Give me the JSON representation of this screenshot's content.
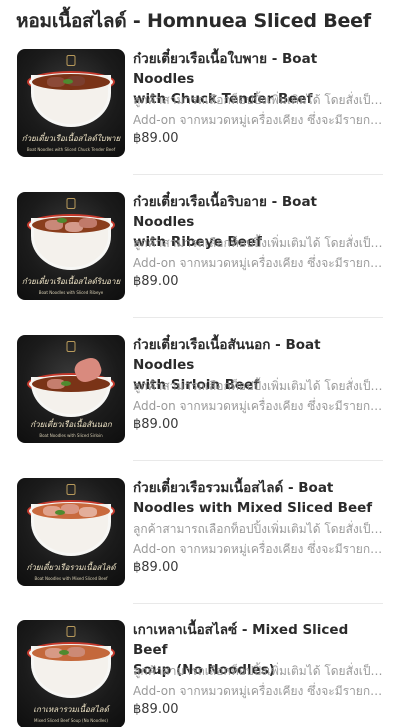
{
  "section": {
    "title": "หอมเนื้อสไลด์ - Homnuea Sliced Beef"
  },
  "items": [
    {
      "name_line1": "ก๋วยเตี๋ยวเรือเนื้อใบพาย - Boat Noodles",
      "name_line2": "with Chuck Tender Beef",
      "desc_line1": "ลูกค้าสามารถเลือกท็อปปิ้งเพิ่มเติมได้ โดยสั่งเป็นเมนู",
      "desc_line2": "Add-on จากหมวดหมู่เครื่องเคียง ซึ่งจะมีรายการต่...",
      "price": "฿89.00",
      "image_caption": "ก๋วยเตี๋ยวเรือเนื้อสไลด์ใบพาย",
      "image_caption_en": "Boat Noodles with Sliced Chuck Tender Beef"
    },
    {
      "name_line1": "ก๋วยเตี๋ยวเรือเนื้อริบอาย - Boat Noodles",
      "name_line2": "with Ribeye Beef",
      "desc_line1": "ลูกค้าสามารถเลือกท็อปปิ้งเพิ่มเติมได้ โดยสั่งเป็นเมนู",
      "desc_line2": "Add-on จากหมวดหมู่เครื่องเคียง ซึ่งจะมีรายการต่...",
      "price": "฿89.00",
      "image_caption": "ก๋วยเตี๋ยวเรือเนื้อสไลด์ริบอาย",
      "image_caption_en": "Boat Noodles with Sliced Ribeye"
    },
    {
      "name_line1": "ก๋วยเตี๋ยวเรือเนื้อสันนอก - Boat Noodles",
      "name_line2": "with Sirloin Beef",
      "desc_line1": "ลูกค้าสามารถเลือกท็อปปิ้งเพิ่มเติมได้ โดยสั่งเป็นเมนู",
      "desc_line2": "Add-on จากหมวดหมู่เครื่องเคียง ซึ่งจะมีรายการต่...",
      "price": "฿89.00",
      "image_caption": "ก๋วยเตี๋ยวเรือเนื้อสันนอก",
      "image_caption_en": "Boat Noodles with Sliced Sirloin"
    },
    {
      "name_line1": "ก๋วยเตี๋ยวเรือรวมเนื้อสไลด์ - Boat",
      "name_line2": "Noodles with Mixed Sliced Beef",
      "desc_line1": "ลูกค้าสามารถเลือกท็อปปิ้งเพิ่มเติมได้ โดยสั่งเป็นเมนู",
      "desc_line2": "Add-on จากหมวดหมู่เครื่องเคียง ซึ่งจะมีรายการต่...",
      "price": "฿89.00",
      "image_caption": "ก๋วยเตี๋ยวเรือรวมเนื้อสไลด์",
      "image_caption_en": "Boat Noodles with Mixed Sliced Beef"
    },
    {
      "name_line1": "เกาเหลาเนื้อสไลซ์ - Mixed Sliced Beef",
      "name_line2": "Soup (No Noodles)",
      "desc_line1": "ลูกค้าสามารถเลือกท็อปปิ้งเพิ่มเติมได้ โดยสั่งเป็นเมนู",
      "desc_line2": "Add-on จากหมวดหมู่เครื่องเคียง ซึ่งจะมีรายการต่...",
      "price": "฿89.00",
      "image_caption": "เกาเหลารวมเนื้อสไลด์",
      "image_caption_en": "Mixed Sliced Beef Soup (No Noodles)"
    }
  ]
}
